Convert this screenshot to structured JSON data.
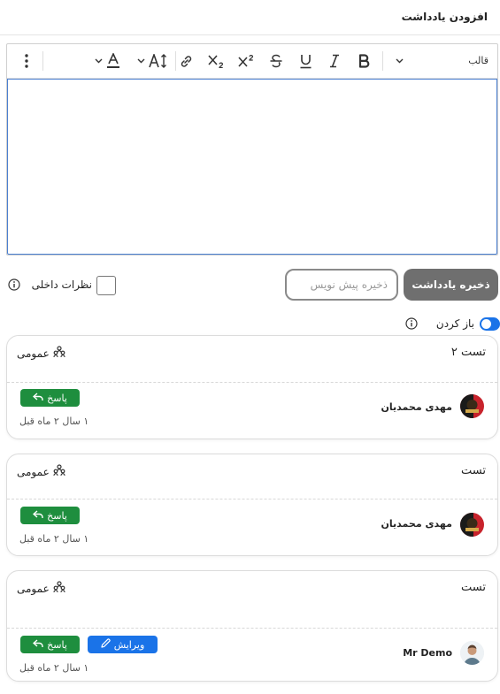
{
  "header": {
    "title": "افزودن یادداشت"
  },
  "toolbar": {
    "format_label": "قالب",
    "icons": [
      "chevron-down-icon",
      "bold-icon",
      "italic-icon",
      "underline-icon",
      "strikethrough-icon",
      "superscript-icon",
      "subscript-icon",
      "link-icon",
      "font-size-icon",
      "text-color-icon",
      "more-vertical-icon"
    ]
  },
  "actions": {
    "save_label": "ذخیره یادداشت",
    "draft_placeholder": "ذخیره پیش نویس",
    "internal_label": "نظرات داخلی",
    "open_label": "باز کردن"
  },
  "colors": {
    "accent": "#1a73e8",
    "reply": "#1e8e3e",
    "save_bg": "#6f6f6f"
  },
  "notes": [
    {
      "text": "تست ۲",
      "visibility": "عمومی",
      "author": "مهدی محمدیان",
      "reply_label": "پاسخ",
      "time": "۱ سال ۲ ماه قبل"
    },
    {
      "text": "تست",
      "visibility": "عمومی",
      "author": "مهدی محمدیان",
      "reply_label": "پاسخ",
      "time": "۱ سال ۲ ماه قبل"
    },
    {
      "text": "تست",
      "visibility": "عمومی",
      "author": "Mr Demo",
      "reply_label": "پاسخ",
      "edit_label": "ویرایش",
      "time": "۱ سال ۲ ماه قبل"
    }
  ]
}
